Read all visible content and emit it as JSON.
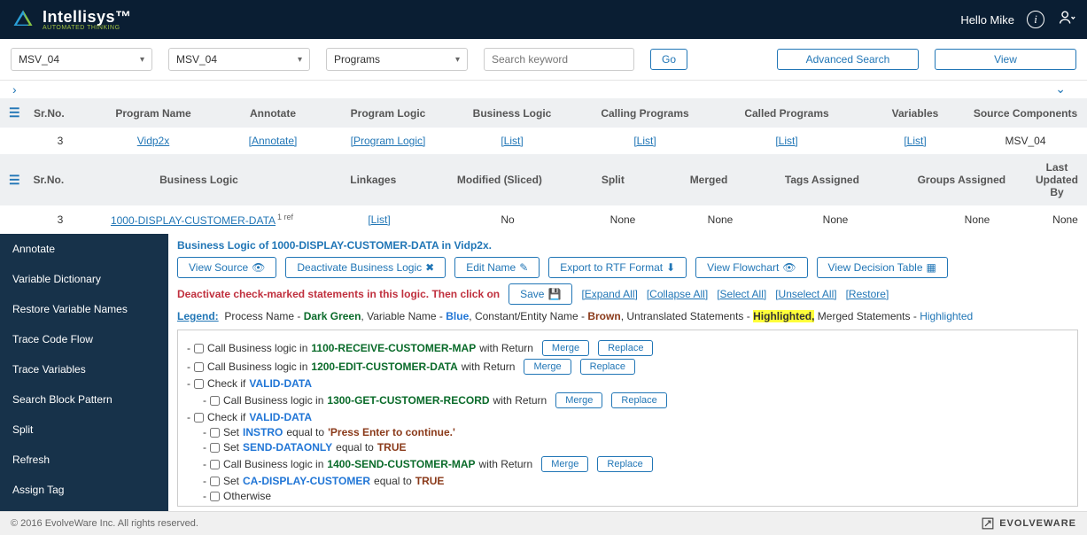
{
  "header": {
    "brand_main": "Intellisys",
    "brand_tm": "™",
    "brand_sub": "AUTOMATED THINKING",
    "greeting": "Hello Mike"
  },
  "filters": {
    "select1": "MSV_04",
    "select2": "MSV_04",
    "select3": "Programs",
    "search_placeholder": "Search keyword",
    "go": "Go",
    "advanced": "Advanced Search",
    "view": "View"
  },
  "table1": {
    "cols": [
      "Sr.No.",
      "Program Name",
      "Annotate",
      "Program Logic",
      "Business Logic",
      "Calling Programs",
      "Called Programs",
      "Variables",
      "Source Components"
    ],
    "row": {
      "srno": "3",
      "pname": "Vidp2x",
      "annot": "[Annotate]",
      "plogic": "[Program Logic]",
      "blogic": "[List]",
      "calling": "[List]",
      "called": "[List]",
      "vars": "[List]",
      "src": "MSV_04"
    }
  },
  "table2": {
    "cols": [
      "Sr.No.",
      "Business Logic",
      "Linkages",
      "Modified (Sliced)",
      "Split",
      "Merged",
      "Tags Assigned",
      "Groups Assigned",
      "Last Updated By"
    ],
    "row": {
      "srno": "3",
      "bl": "1000-DISPLAY-CUSTOMER-DATA",
      "ref": "1 ref",
      "link": "[List]",
      "mod": "No",
      "split": "None",
      "merged": "None",
      "tags": "None",
      "groups": "None",
      "upd": "None"
    }
  },
  "sidebar": {
    "items": [
      "Annotate",
      "Variable Dictionary",
      "Restore Variable Names",
      "Trace Code Flow",
      "Trace Variables",
      "Search Block Pattern",
      "Split",
      "Refresh",
      "Assign Tag"
    ]
  },
  "content": {
    "title": "Business Logic of 1000-DISPLAY-CUSTOMER-DATA in Vidp2x.",
    "buttons": {
      "view_source": "View Source",
      "deactivate": "Deactivate Business Logic",
      "edit_name": "Edit Name",
      "export": "Export to RTF Format",
      "flowchart": "View Flowchart",
      "decision": "View Decision Table"
    },
    "warn": "Deactivate check-marked statements in this logic. Then click on",
    "save": "Save",
    "links": [
      "[Expand All]",
      "[Collapse All]",
      "[Select All]",
      "[Unselect All]",
      "[Restore]"
    ],
    "legend": {
      "label": "Legend:",
      "process": "Process Name -",
      "process_v": "Dark Green",
      "variable": "Variable Name -",
      "variable_v": "Blue",
      "constant": "Constant/Entity Name -",
      "constant_v": "Brown",
      "untranslated": "Untranslated Statements -",
      "untranslated_v": "Highlighted,",
      "merged": "Merged Statements -",
      "merged_v": "Highlighted"
    },
    "actions": {
      "merge": "Merge",
      "replace": "Replace"
    },
    "stmts": {
      "s1a": "Call Business logic in",
      "s1b": "1100-RECEIVE-CUSTOMER-MAP",
      "s1c": "with Return",
      "s2a": "Call Business logic in",
      "s2b": "1200-EDIT-CUSTOMER-DATA",
      "s2c": "with Return",
      "s3a": "Check if",
      "s3b": "VALID-DATA",
      "s4a": "Call Business logic in",
      "s4b": "1300-GET-CUSTOMER-RECORD",
      "s4c": "with Return",
      "s5a": "Check if",
      "s5b": "VALID-DATA",
      "s6a": "Set",
      "s6b": "INSTRO",
      "s6c": "equal to",
      "s6d": "'Press Enter to continue.'",
      "s7a": "Set",
      "s7b": "SEND-DATAONLY",
      "s7c": "equal to",
      "s7d": "TRUE",
      "s8a": "Call Business logic in",
      "s8b": "1400-SEND-CUSTOMER-MAP",
      "s8c": "with Return",
      "s9a": "Set",
      "s9b": "CA-DISPLAY-CUSTOMER",
      "s9c": "equal to",
      "s9d": "TRUE",
      "s10a": "Otherwise"
    }
  },
  "footer": {
    "copyright": "© 2016 EvolveWare Inc. All rights reserved.",
    "brand": "EVOLVEWARE"
  }
}
